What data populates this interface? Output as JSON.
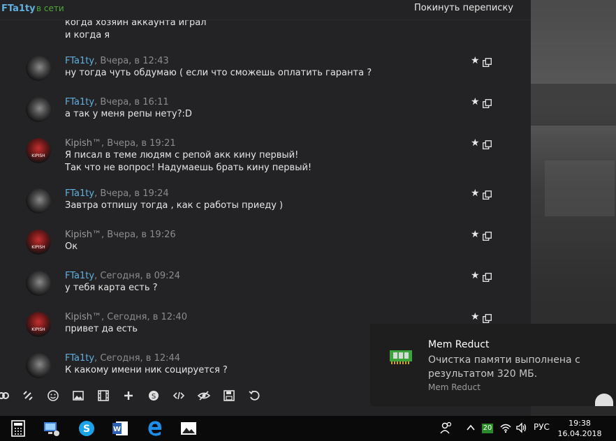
{
  "header": {
    "peer_name": "FTa1ty",
    "status": "в сети",
    "leave_label": "Покинуть переписку"
  },
  "partial": {
    "line1": "когда хозяин аккаунта играл",
    "line2": "и когда я"
  },
  "messages": [
    {
      "author": "FTa1ty",
      "time": ", Вчера, в 12:43",
      "lines": [
        "ну тогда чуть обдумаю ( если что сможешь оплатить гаранта ?"
      ]
    },
    {
      "author": "FTa1ty",
      "time": ", Вчера, в 16:11",
      "lines": [
        "а так у меня репы нету?:D"
      ]
    },
    {
      "author": "Kipish™",
      "time": ", Вчера, в 19:21",
      "lines": [
        "Я писал в теме людям с репой акк кину первый!",
        "Так что не вопрос! Надумаешь брать кину первый!"
      ]
    },
    {
      "author": "FTa1ty",
      "time": ", Вчера, в 19:24",
      "lines": [
        "Завтра отпишу тогда , как с работы приеду )"
      ]
    },
    {
      "author": "Kipish™",
      "time": ", Вчера, в 19:26",
      "lines": [
        "Ок"
      ]
    },
    {
      "author": "FTa1ty",
      "time": ", Сегодня, в 09:24",
      "lines": [
        "у тебя карта есть ?"
      ]
    },
    {
      "author": "Kipish™",
      "time": ", Сегодня, в 12:40",
      "lines": [
        "привет да есть"
      ]
    },
    {
      "author": "FTa1ty",
      "time": ", Сегодня, в 12:44",
      "lines": [
        "К какому имени ник социруется ?"
      ]
    }
  ],
  "avatar_text": "KIPISH",
  "toast": {
    "title": "Mem Reduct",
    "body": "Очистка памяти выполнена с результатом 320 МБ.",
    "app": "Mem Reduct"
  },
  "taskbar": {
    "lang": "РУС",
    "time": "19:38",
    "date": "16.04.2018",
    "badge": "20"
  },
  "colors": {
    "accent": "#5fb0e0",
    "online": "#4fa83a",
    "background": "#232325"
  }
}
